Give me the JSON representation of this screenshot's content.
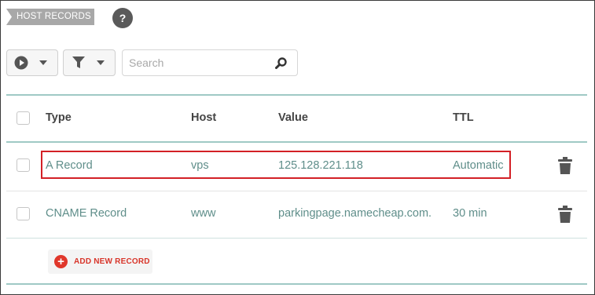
{
  "section": {
    "title": "HOST RECORDS",
    "help": "?"
  },
  "toolbar": {
    "search_placeholder": "Search"
  },
  "table": {
    "headers": {
      "type": "Type",
      "host": "Host",
      "value": "Value",
      "ttl": "TTL"
    },
    "rows": [
      {
        "type": "A Record",
        "host": "vps",
        "value": "125.128.221.118",
        "ttl": "Automatic"
      },
      {
        "type": "CNAME Record",
        "host": "www",
        "value": "parkingpage.namecheap.com.",
        "ttl": "30 min"
      }
    ]
  },
  "add_record": {
    "label": "ADD NEW RECORD"
  },
  "colors": {
    "accent": "#5f8e8a",
    "highlight": "#d32026",
    "add": "#e0372b",
    "rule": "#9fc9c5"
  },
  "icons": [
    "play-icon",
    "chevron-down-icon",
    "filter-icon",
    "search-icon",
    "trash-icon",
    "plus-icon",
    "help-icon"
  ]
}
